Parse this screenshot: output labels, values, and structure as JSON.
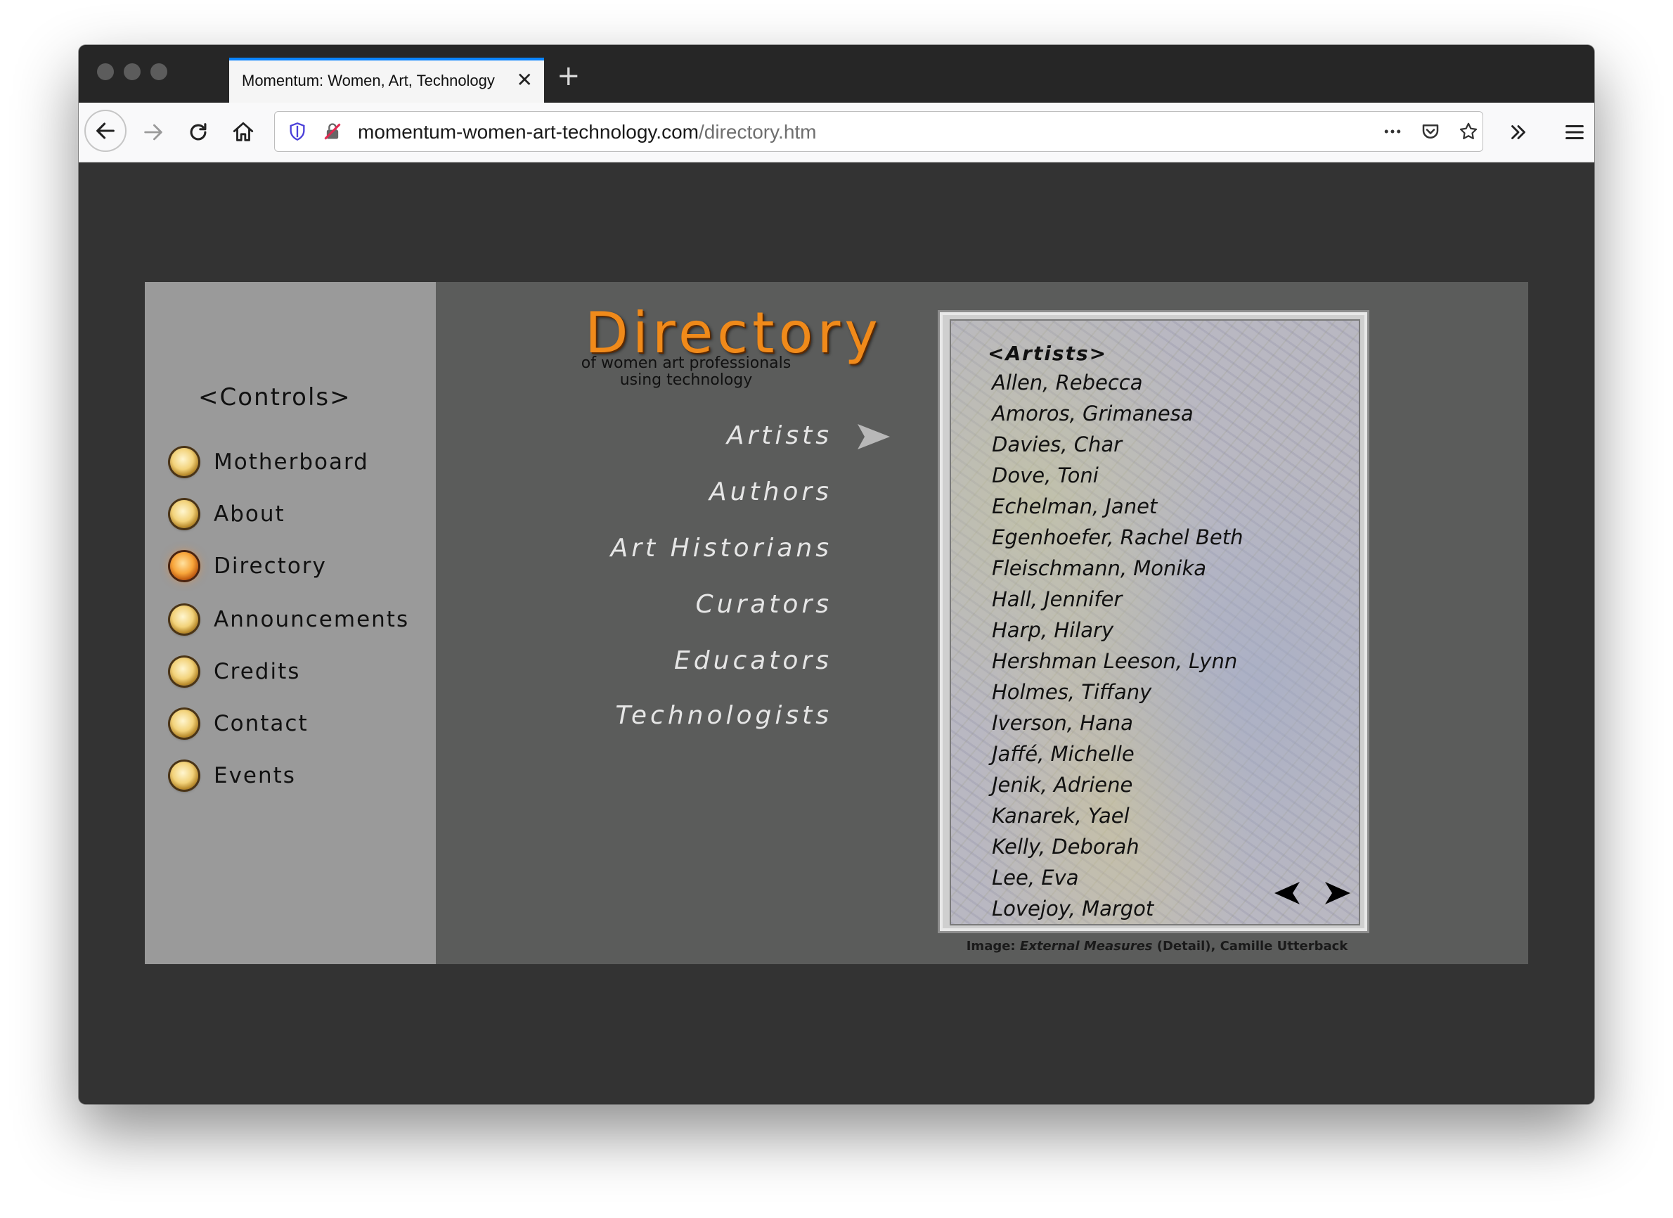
{
  "browser": {
    "tab_title": "Momentum: Women, Art, Technology",
    "url_domain": "momentum-women-art-technology.com",
    "url_path": "/directory.htm",
    "accent_color": "#0a84ff"
  },
  "sidebar": {
    "title": "<Controls>",
    "items": [
      {
        "label": "Motherboard"
      },
      {
        "label": "About"
      },
      {
        "label": "Directory",
        "active": true
      },
      {
        "label": "Announcements"
      },
      {
        "label": "Credits"
      },
      {
        "label": "Contact"
      },
      {
        "label": "Events"
      }
    ]
  },
  "header": {
    "title": "Directory",
    "subtitle_line1": "of women art professionals",
    "subtitle_line2": "using technology",
    "title_color": "#f08a1a"
  },
  "categories": [
    {
      "label": "Artists",
      "selected": true
    },
    {
      "label": "Authors"
    },
    {
      "label": "Art Historians"
    },
    {
      "label": "Curators"
    },
    {
      "label": "Educators"
    },
    {
      "label": "Technologists"
    }
  ],
  "panel": {
    "heading": "<Artists>",
    "names": [
      "Allen, Rebecca",
      "Amoros, Grimanesa",
      "Davies, Char",
      "Dove, Toni",
      "Echelman, Janet",
      "Egenhoefer, Rachel Beth",
      "Fleischmann, Monika",
      "Hall, Jennifer",
      "Harp, Hilary",
      "Hershman Leeson, Lynn",
      "Holmes, Tiffany",
      "Iverson, Hana",
      "Jaffé, Michelle",
      "Jenik, Adriene",
      "Kanarek, Yael",
      "Kelly, Deborah",
      "Lee, Eva",
      "Lovejoy, Margot"
    ]
  },
  "caption": {
    "prefix": "Image: ",
    "work": "External Measures",
    "suffix": " (Detail), Camille Utterback"
  }
}
